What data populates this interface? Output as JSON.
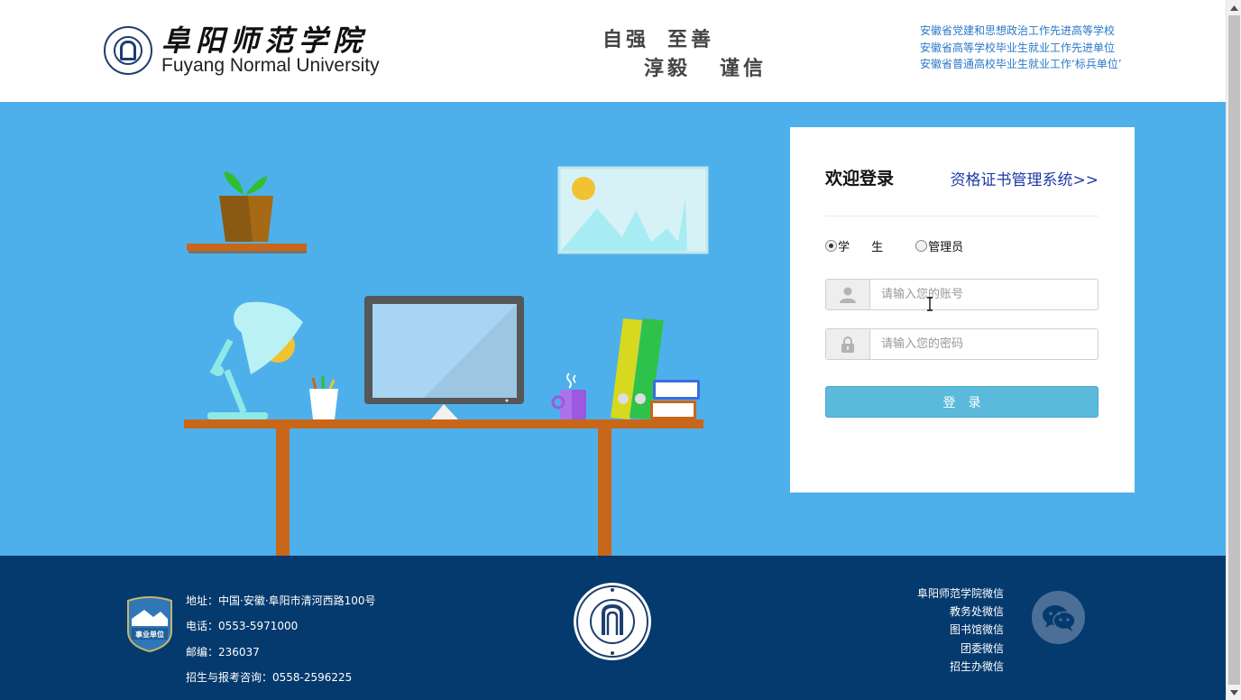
{
  "header": {
    "logo_cn": "阜阳师范学院",
    "logo_en": "Fuyang Normal University",
    "motto": [
      "自强",
      "至善",
      "淳毅",
      "谨信"
    ],
    "honors": [
      "安徽省党建和思想政治工作先进高等学校",
      "安徽省高等学校毕业生就业工作先进单位",
      "安徽省普通高校毕业生就业工作‘标兵单位’"
    ]
  },
  "login": {
    "title": "欢迎登录",
    "cert_link": "资格证书管理系统>>",
    "roles": [
      {
        "label": "学 生",
        "checked": true
      },
      {
        "label": "管理员",
        "checked": false
      }
    ],
    "username_placeholder": "请输入您的账号",
    "password_placeholder": "请输入您的密码",
    "submit_label": "登录"
  },
  "footer": {
    "badge_text": "事业单位",
    "address": "地址：中国·安徽·阜阳市清河西路100号",
    "phone": "电话：0553-5971000",
    "postcode": "邮编：236037",
    "admissions": "招生与报考咨询：0558-2596225",
    "wechat_links": [
      "阜阳师范学院微信",
      "教务处微信",
      "图书馆微信",
      "团委微信",
      "招生办微信"
    ]
  },
  "colors": {
    "hero_bg": "#4eb0ea",
    "footer_bg": "#053a6e",
    "button": "#5bbadc",
    "link": "#1d3aa8",
    "honor_text": "#2a78c8"
  },
  "icons": [
    "university-seal-icon",
    "user-icon",
    "lock-icon",
    "wechat-icon",
    "scroll-up-icon",
    "scroll-down-icon"
  ]
}
